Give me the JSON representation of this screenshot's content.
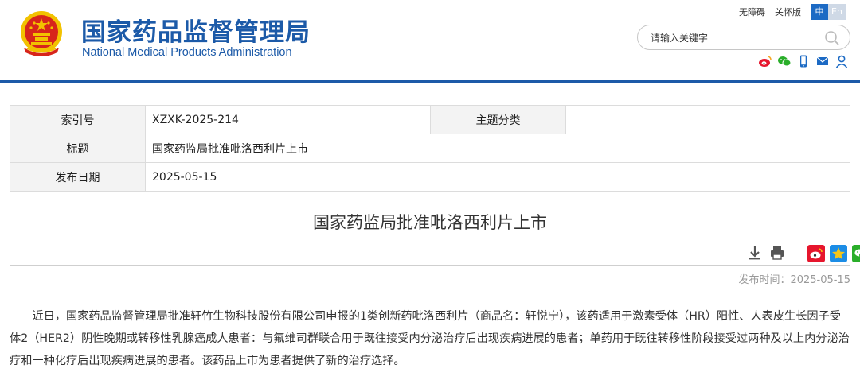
{
  "header": {
    "site_title_cn": "国家药品监督管理局",
    "site_title_en": "National Medical Products Administration",
    "accessibility_link": "无障碍",
    "elder_mode_link": "关怀版",
    "lang_zh": "中",
    "lang_en": "En",
    "search_placeholder": "请输入关键字",
    "share_icons": [
      "weibo-icon",
      "wechat-icon",
      "mobile-icon",
      "mail-icon",
      "user-icon"
    ]
  },
  "info_table": {
    "index_label": "索引号",
    "index_value": "XZXK-2025-214",
    "category_label": "主题分类",
    "category_value": "",
    "title_label": "标题",
    "title_value": "国家药监局批准吡洛西利片上市",
    "date_label": "发布日期",
    "date_value": "2025-05-15"
  },
  "article": {
    "title": "国家药监局批准吡洛西利片上市",
    "publish_time": "发布时间：2025-05-15",
    "body": "近日，国家药品监督管理局批准轩竹生物科技股份有限公司申报的1类创新药吡洛西利片（商品名：轩悦宁），该药适用于激素受体（HR）阳性、人表皮生长因子受体2（HER2）阴性晚期或转移性乳腺癌成人患者：与氟维司群联合用于既往接受内分泌治疗后出现疾病进展的患者；单药用于既往转移性阶段接受过两种及以上内分泌治疗和一种化疗后出现疾病进展的患者。该药品上市为患者提供了新的治疗选择。",
    "tool_icons": [
      "download-icon",
      "print-icon",
      "weibo-share-icon",
      "qzone-share-icon",
      "wechat-share-icon"
    ]
  },
  "colors": {
    "brand_blue": "#1c5aa8",
    "emblem_red": "#d7251b",
    "emblem_gold": "#f2c200"
  }
}
